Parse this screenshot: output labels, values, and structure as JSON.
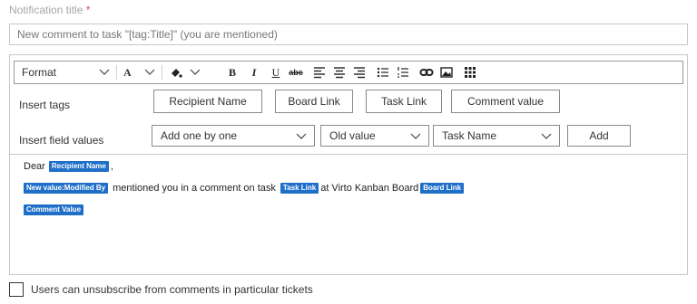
{
  "notification_title": {
    "label": "Notification title",
    "required_mark": "*",
    "value": "New comment to task \"[tag:Title]\" (you are mentioned)"
  },
  "toolbar": {
    "format_label": "Format",
    "font_label": "A",
    "buttons": [
      "bold-icon",
      "italic-icon",
      "underline-icon",
      "strikethrough-icon",
      "align-left-icon",
      "align-center-icon",
      "align-right-icon",
      "bullet-list-icon",
      "numbered-list-icon",
      "link-icon",
      "image-icon",
      "table-icon"
    ]
  },
  "insert_tags": {
    "label": "Insert tags",
    "buttons": [
      "Recipient Name",
      "Board Link",
      "Task Link",
      "Comment value"
    ]
  },
  "insert_field_values": {
    "label": "Insert field values",
    "mode": "Add one by one",
    "value_type": "Old value",
    "field": "Task Name",
    "add_label": "Add"
  },
  "body": {
    "line1_text": "Dear",
    "line1_chip": "Recipient Name",
    "line1_end": ",",
    "line2_chip1": "New value:Modified By",
    "line2_text1": "mentioned you in a comment on task",
    "line2_chip2": "Task Link",
    "line2_text2": "at Virto Kanban Board",
    "line2_chip3": "Board Link",
    "line3_chip": "Comment Value"
  },
  "unsubscribe": {
    "label": "Users can unsubscribe from comments in particular tickets",
    "checked": false
  },
  "colors": {
    "chip": "#1f6fc9",
    "required": "#e04848"
  }
}
